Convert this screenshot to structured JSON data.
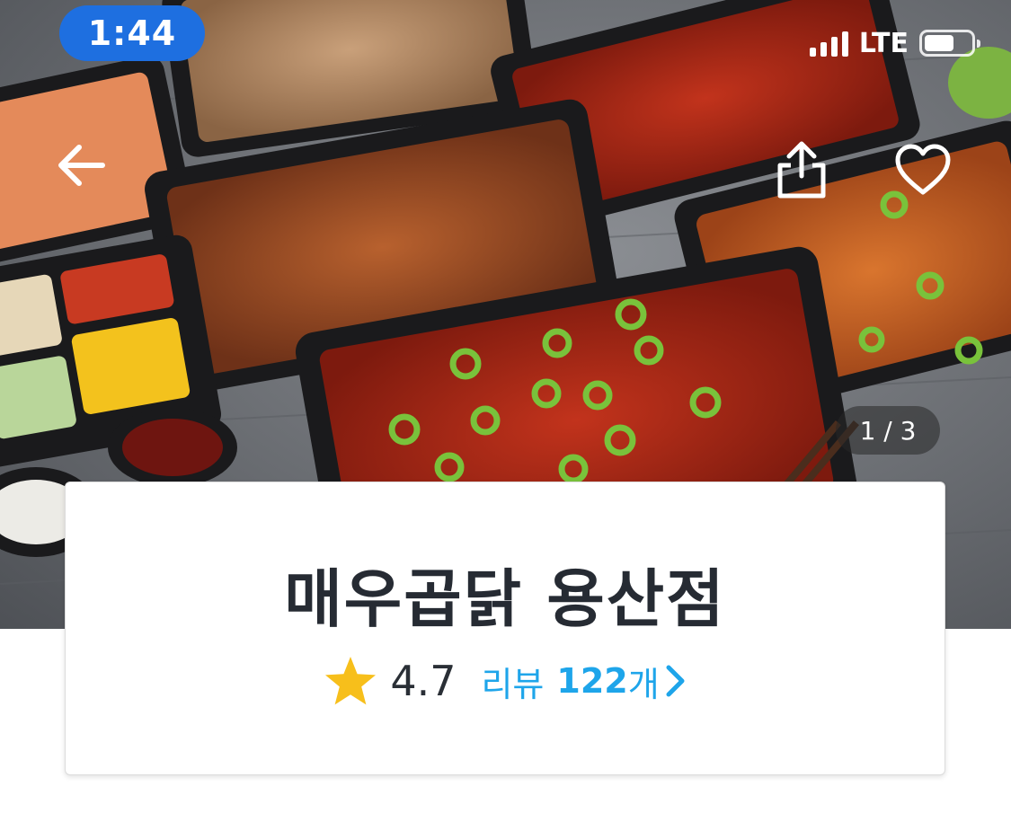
{
  "status_bar": {
    "time": "1:44",
    "network": "LTE"
  },
  "hero": {
    "page_indicator": "1 / 3"
  },
  "icons": {
    "back": "arrow-left-icon",
    "share": "share-icon",
    "favorite": "heart-icon",
    "rating_star": "star-icon",
    "review_chevron": "chevron-right-icon"
  },
  "store": {
    "name": "매우곱닭 용산점",
    "rating": "4.7",
    "review_label": "리뷰",
    "review_count": "122",
    "review_unit": "개"
  },
  "colors": {
    "accent": "#1ea5ea",
    "time_pill": "#1e6fe0",
    "star": "#f7bf1b",
    "title": "#262b33"
  }
}
